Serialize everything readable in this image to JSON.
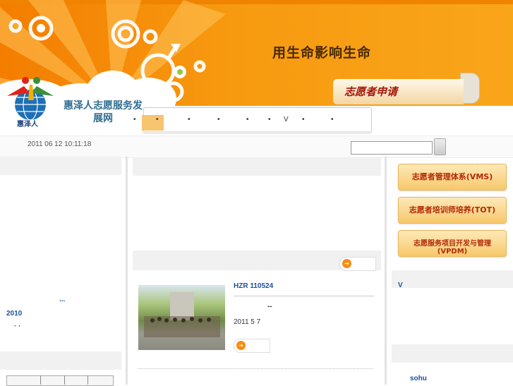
{
  "header": {
    "slogan": "用生命影响生命",
    "apply_label": "志愿者申请",
    "site_name": "惠泽人志愿服务发展网",
    "logo_text": "惠泽人"
  },
  "nav": {
    "items": [
      "•",
      "•",
      "•",
      "•",
      "•",
      "•",
      "V",
      "•",
      "•"
    ]
  },
  "toolbar": {
    "date": "2011 06 12  10:11:18",
    "search_placeholder": ""
  },
  "left": {
    "ellipsis": "...",
    "year": "2010",
    "dots": "·  ·"
  },
  "center": {
    "news_title": "HZR    110524",
    "news_dash": "--",
    "news_date": "2011  5  7"
  },
  "right": {
    "buttons": [
      "志愿者管理体系(VMS)",
      "志愿者培训师培养(TOT)",
      "志愿服务项目开发与管理(VPDM)"
    ],
    "section_label": "V",
    "link": "sohu"
  },
  "colors": {
    "banner": "#f79a10",
    "accent": "#f58d12",
    "link": "#1b4f9c"
  }
}
